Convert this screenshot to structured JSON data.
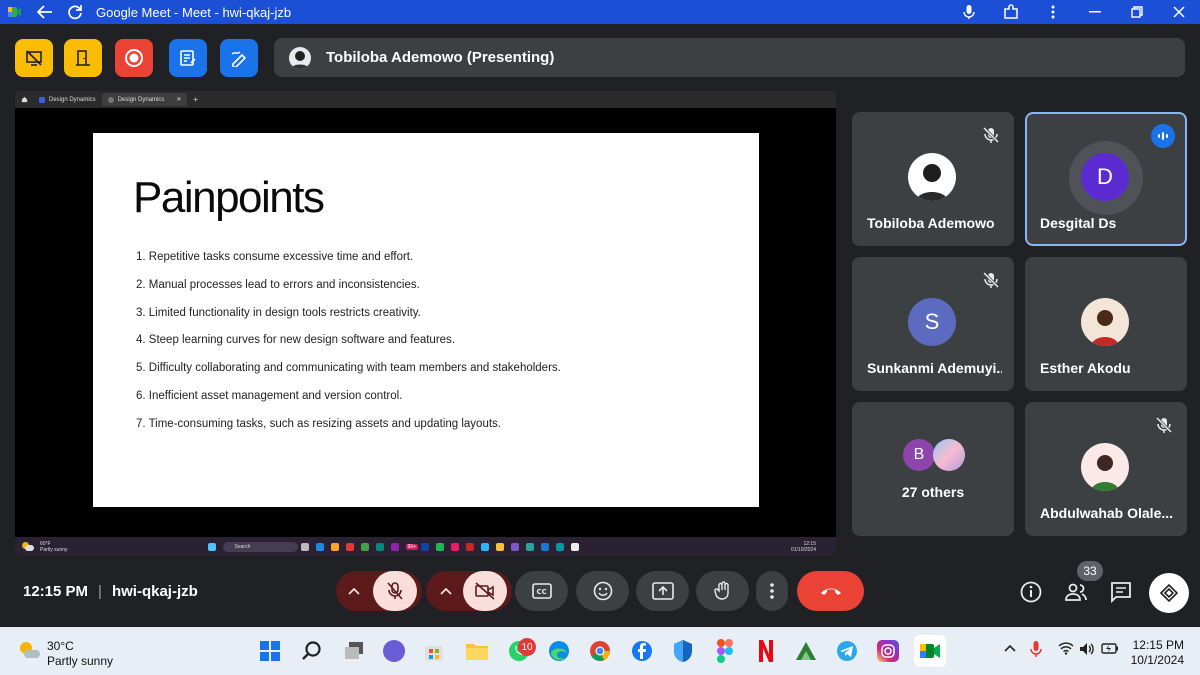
{
  "window": {
    "title": "Google Meet - Meet - hwi-qkaj-jzb"
  },
  "presenting": {
    "label": "Tobiloba Ademowo (Presenting)"
  },
  "shared_browser": {
    "tabs": [
      "Design Dynamics",
      "Design Dynamics"
    ]
  },
  "slide": {
    "title": "Painpoints",
    "items": [
      "1. Repetitive tasks consume excessive time and effort.",
      "2. Manual processes lead to errors and inconsistencies.",
      "3. Limited functionality in design tools restricts creativity.",
      "4. Steep learning curves for new design software and features.",
      "5. Difficulty collaborating and communicating with team members and stakeholders.",
      "6. Inefficient asset management and version control.",
      "7. Time-consuming tasks, such as resizing assets and updating layouts."
    ]
  },
  "mini_taskbar": {
    "weather_temp": "60°F",
    "weather_desc": "Partly sunny",
    "search_placeholder": "Search",
    "time": "12:15",
    "date": "01/10/2024",
    "badge": "99+"
  },
  "participants": [
    {
      "name": "Tobiloba Ademowo",
      "initial": "",
      "muted": true,
      "speaking": false
    },
    {
      "name": "Desgital Ds",
      "initial": "D",
      "muted": false,
      "speaking": true,
      "color": "#5b2bd1"
    },
    {
      "name": "Sunkanmi Ademuyi...",
      "initial": "S",
      "muted": true,
      "speaking": false,
      "color": "#5c6bc0"
    },
    {
      "name": "Esther Akodu",
      "initial": "",
      "muted": false,
      "speaking": false
    },
    {
      "name": "27 others",
      "initial": "B",
      "muted": false,
      "speaking": false,
      "color": "#8e44ad"
    },
    {
      "name": "Abdulwahab Olale...",
      "initial": "",
      "muted": true,
      "speaking": false
    }
  ],
  "meeting": {
    "time": "12:15 PM",
    "separator": "|",
    "code": "hwi-qkaj-jzb",
    "people_count": "33"
  },
  "taskbar": {
    "weather_temp": "30°C",
    "weather_desc": "Partly sunny",
    "whatsapp_badge": "10",
    "time": "12:15 PM",
    "date": "10/1/2024"
  },
  "colors": {
    "accent": "#1a4fd6",
    "end_call": "#ea4335",
    "tile_bg": "#3c4043",
    "active_border": "#8ab4f8"
  }
}
